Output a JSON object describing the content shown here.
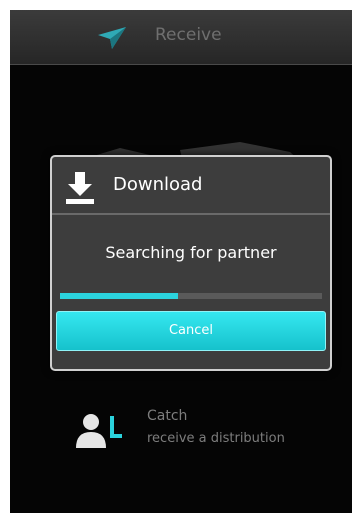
{
  "titlebar": {
    "title": "Receive",
    "icon": "paper-plane-icon"
  },
  "dialog": {
    "title": "Download",
    "icon": "download-icon",
    "message": "Searching for partner",
    "progress_fraction": 0.45,
    "cancel_label": "Cancel"
  },
  "menu": {
    "catch": {
      "title": "Catch",
      "subtitle": "receive a distribution",
      "icon": "person-receive-icon"
    }
  },
  "colors": {
    "accent": "#2bd3dd",
    "background": "#050505",
    "dialog_bg": "#3d3d3d"
  }
}
